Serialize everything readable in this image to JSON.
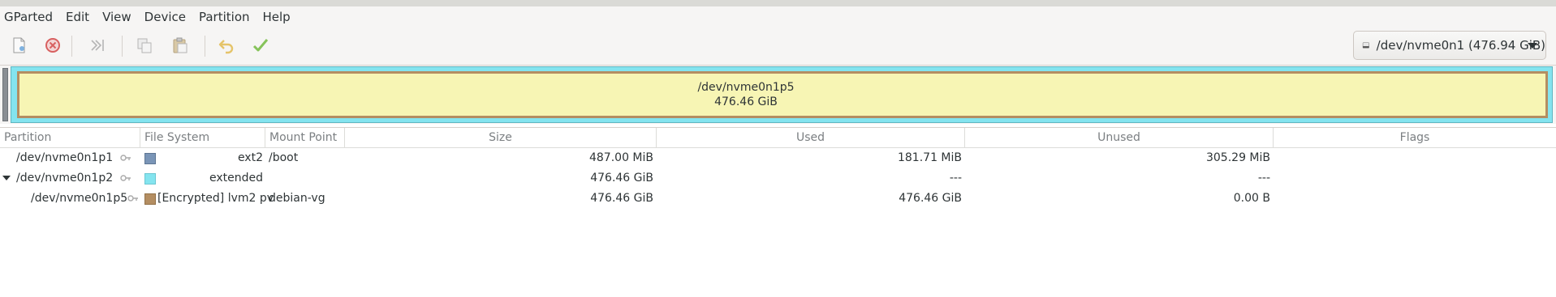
{
  "menubar": {
    "items": [
      "GParted",
      "Edit",
      "View",
      "Device",
      "Partition",
      "Help"
    ]
  },
  "toolbar": {
    "buttons": [
      {
        "name": "new",
        "icon": "new-partition-icon"
      },
      {
        "name": "delete",
        "icon": "delete-icon"
      },
      {
        "name": "resize-move",
        "icon": "resize-move-icon"
      },
      {
        "name": "copy",
        "icon": "copy-icon"
      },
      {
        "name": "paste",
        "icon": "paste-icon"
      },
      {
        "name": "undo",
        "icon": "undo-icon"
      },
      {
        "name": "apply",
        "icon": "apply-checkmark-icon"
      }
    ]
  },
  "device_selector": {
    "label": "/dev/nvme0n1 (476.94 GiB)"
  },
  "disk_map": {
    "partition_name": "/dev/nvme0n1p5",
    "partition_size": "476.46 GiB",
    "colors": {
      "extended": "#84e4ef",
      "lvm2": "#b48e62",
      "fill": "#f7f5b4",
      "unallocated": "#8a8f94"
    }
  },
  "table": {
    "headers": [
      "Partition",
      "File System",
      "Mount Point",
      "Size",
      "Used",
      "Unused",
      "Flags"
    ],
    "rows": [
      {
        "partition": "/dev/nvme0n1p1",
        "fs": "ext2",
        "fs_color": "#7a95b7",
        "mount": "/boot",
        "size": "487.00 MiB",
        "used": "181.71 MiB",
        "unused": "305.29 MiB",
        "flags": ""
      },
      {
        "partition": "/dev/nvme0n1p2",
        "fs": "extended",
        "fs_color": "#84e4ef",
        "mount": "",
        "size": "476.46 GiB",
        "used": "---",
        "unused": "---",
        "flags": ""
      },
      {
        "partition": "/dev/nvme0n1p5",
        "fs": "[Encrypted] lvm2 pv",
        "fs_color": "#b48e62",
        "mount": "debian-vg",
        "size": "476.46 GiB",
        "used": "476.46 GiB",
        "unused": "0.00 B",
        "flags": ""
      }
    ]
  }
}
